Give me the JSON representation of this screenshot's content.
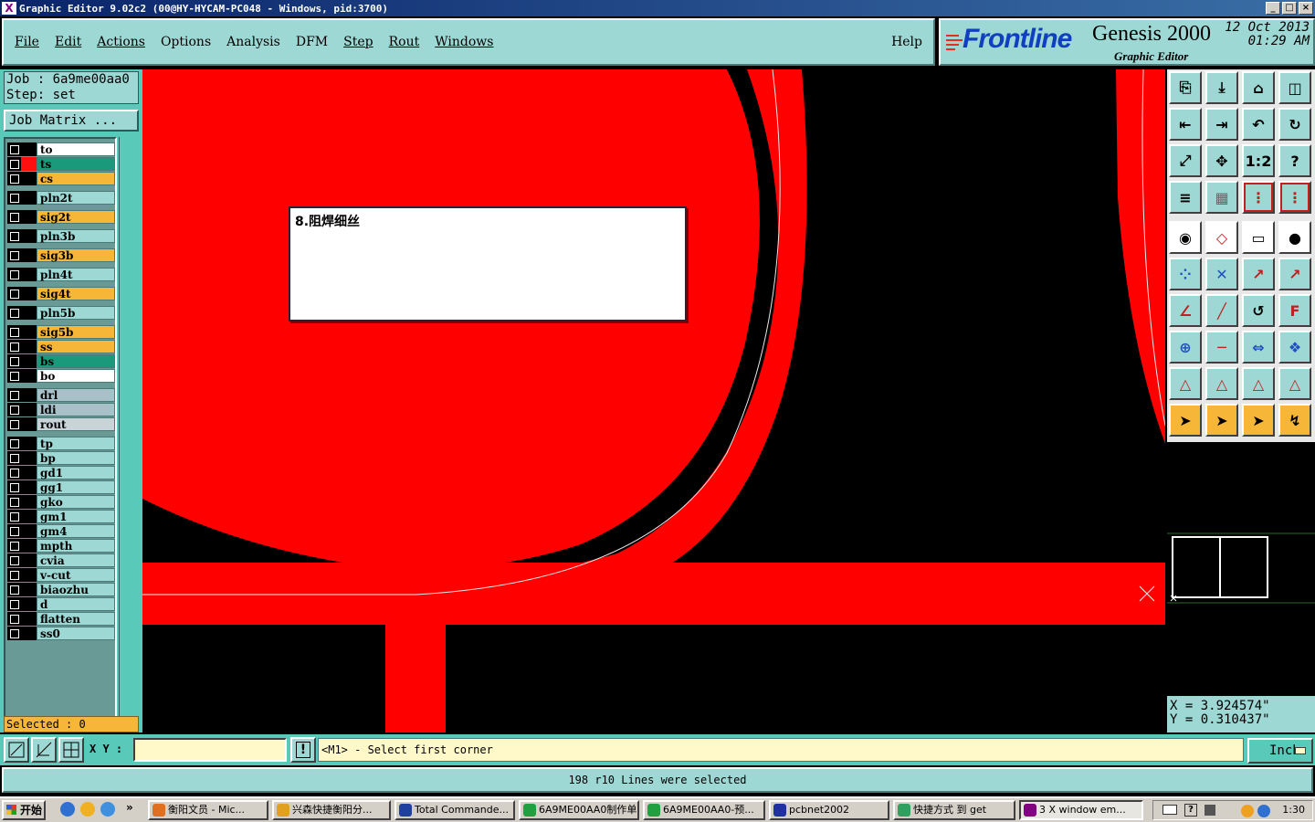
{
  "window": {
    "title": "Graphic Editor 9.02c2 (00@HY-HYCAM-PC048 - Windows, pid:3700)",
    "controls": {
      "minimize": "_",
      "maximize": "□",
      "close": "×"
    },
    "icon_glyph": "X"
  },
  "menu": {
    "items": [
      {
        "label": "File",
        "underline": true
      },
      {
        "label": "Edit",
        "underline": true
      },
      {
        "label": "Actions",
        "underline": true
      },
      {
        "label": "Options",
        "underline": false
      },
      {
        "label": "Analysis",
        "underline": false
      },
      {
        "label": "DFM",
        "underline": false
      },
      {
        "label": "Step",
        "underline": true
      },
      {
        "label": "Rout",
        "underline": true
      },
      {
        "label": "Windows",
        "underline": true
      }
    ],
    "help": "Help"
  },
  "brand": {
    "logo": "Frontline",
    "product": "Genesis 2000",
    "subtitle": "Graphic Editor",
    "date_line1": "12 Oct 2013",
    "date_line2": "01:29 AM"
  },
  "job": {
    "job_line": "Job : 6a9me00aa0",
    "step_line": "Step: set",
    "matrix_button": "Job Matrix ..."
  },
  "layers": [
    {
      "name": "to",
      "bg": "#ffffff",
      "display": ""
    },
    {
      "name": "ts",
      "bg": "#1a9a7a",
      "display": "#ff1010",
      "active": true
    },
    {
      "name": "cs",
      "bg": "#f6b738",
      "display": ""
    },
    {
      "name": "pln2t",
      "bg": "#9ed8d4",
      "display": ""
    },
    {
      "name": "sig2t",
      "bg": "#f6b738",
      "display": ""
    },
    {
      "name": "pln3b",
      "bg": "#9ed8d4",
      "display": ""
    },
    {
      "name": "sig3b",
      "bg": "#f6b738",
      "display": ""
    },
    {
      "name": "pln4t",
      "bg": "#9ed8d4",
      "display": ""
    },
    {
      "name": "sig4t",
      "bg": "#f6b738",
      "display": ""
    },
    {
      "name": "pln5b",
      "bg": "#9ed8d4",
      "display": ""
    },
    {
      "name": "sig5b",
      "bg": "#f6b738",
      "display": ""
    },
    {
      "name": "ss",
      "bg": "#f6b738",
      "display": ""
    },
    {
      "name": "bs",
      "bg": "#1a9a7a",
      "display": ""
    },
    {
      "name": "bo",
      "bg": "#ffffff",
      "display": ""
    },
    {
      "name": "drl",
      "bg": "#a8c0c8",
      "display": ""
    },
    {
      "name": "ldi",
      "bg": "#a8c0c8",
      "display": ""
    },
    {
      "name": "rout",
      "bg": "#c8d4d8",
      "display": ""
    },
    {
      "name": "tp",
      "bg": "#9ed8d4",
      "display": ""
    },
    {
      "name": "bp",
      "bg": "#9ed8d4",
      "display": ""
    },
    {
      "name": "gd1",
      "bg": "#9ed8d4",
      "display": ""
    },
    {
      "name": "gg1",
      "bg": "#9ed8d4",
      "display": ""
    },
    {
      "name": "gko",
      "bg": "#9ed8d4",
      "display": ""
    },
    {
      "name": "gm1",
      "bg": "#9ed8d4",
      "display": ""
    },
    {
      "name": "gm4",
      "bg": "#9ed8d4",
      "display": ""
    },
    {
      "name": "mpth",
      "bg": "#9ed8d4",
      "display": ""
    },
    {
      "name": "cvia",
      "bg": "#9ed8d4",
      "display": ""
    },
    {
      "name": "v-cut",
      "bg": "#9ed8d4",
      "display": ""
    },
    {
      "name": "biaozhu",
      "bg": "#9ed8d4",
      "display": ""
    },
    {
      "name": "d",
      "bg": "#9ed8d4",
      "display": ""
    },
    {
      "name": "flatten",
      "bg": "#9ed8d4",
      "display": ""
    },
    {
      "name": "ss0",
      "bg": "#9ed8d4",
      "display": ""
    }
  ],
  "selected": "Selected : 0",
  "canvas": {
    "note_text": "8.阻焊细丝",
    "copper_color": "#ff0000"
  },
  "coords": {
    "x": "X = 3.924574\"",
    "y": "Y = 0.310437\""
  },
  "command": {
    "xy_label": "X Y :",
    "xy_value": "",
    "alert_glyph": "!",
    "prompt": "<M1> - Select first corner",
    "unit": "Inch"
  },
  "status": "198 r10 Lines were selected",
  "taskbar": {
    "start": "开始",
    "items": [
      {
        "label": "衡阳文员 - Mic...",
        "icon": "#e07020"
      },
      {
        "label": "兴森快捷衡阳分...",
        "icon": "#e0a020"
      },
      {
        "label": "Total Commande...",
        "icon": "#2040a0"
      },
      {
        "label": "6A9ME00AA0制作单",
        "icon": "#20a040"
      },
      {
        "label": "6A9ME00AA0-预...",
        "icon": "#20a040"
      },
      {
        "label": "pcbnet2002",
        "icon": "#2030a0"
      },
      {
        "label": "快捷方式 到 get",
        "icon": "#30a060"
      },
      {
        "label": "3 X window em...",
        "icon": "#800080",
        "active": true
      }
    ],
    "clock": "1:30"
  },
  "icons": {
    "toolbox": [
      "open-icon",
      "save-icon",
      "home-icon",
      "window-icon",
      "zoom-prev-icon",
      "zoom-next-icon",
      "undo-icon",
      "redraw-icon",
      "fit-icon",
      "center-icon",
      "scale-1-2-icon",
      "help-icon",
      "snap-icon",
      "grid-icon",
      "layers-a-icon",
      "layers-b-icon",
      "photo-icon",
      "select-area-icon",
      "ruler-icon",
      "pad-icon",
      "node-icon",
      "delete-icon",
      "move-icon",
      "copy-icon",
      "angle-icon",
      "line-icon",
      "arc-icon",
      "text-icon",
      "resize-icon",
      "trim-icon",
      "measure-icon",
      "shapes-icon",
      "triangle-icon",
      "triangle-b-icon",
      "triangle-c-icon",
      "triangle-d-icon",
      "pointer-icon",
      "pointer-b-icon",
      "pointer-c-icon",
      "route-icon"
    ]
  }
}
